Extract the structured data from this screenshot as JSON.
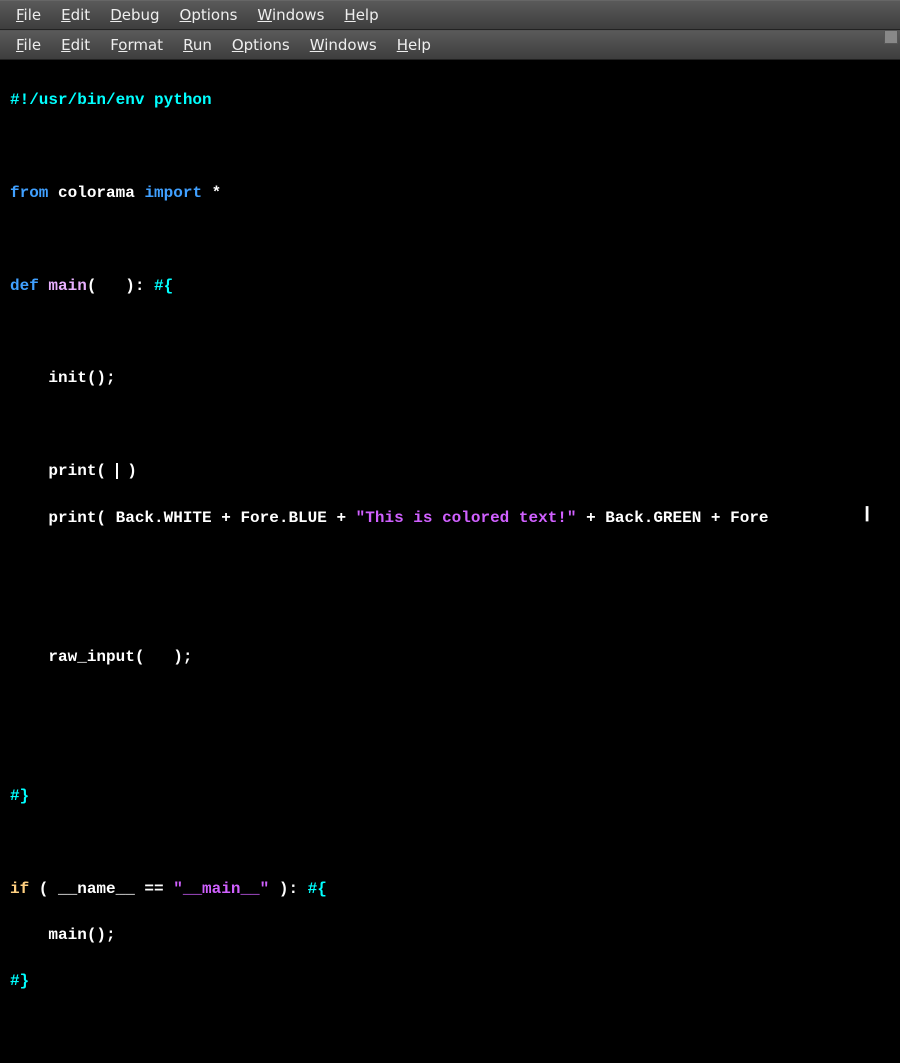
{
  "menubar1": {
    "file": "File",
    "edit": "Edit",
    "debug": "Debug",
    "options": "Options",
    "windows": "Windows",
    "help": "Help"
  },
  "menubar2": {
    "file": "File",
    "edit": "Edit",
    "format": "Format",
    "run": "Run",
    "options": "Options",
    "windows": "Windows",
    "help": "Help"
  },
  "code": {
    "l1": "#!/usr/bin/env python",
    "l3_from": "from",
    "l3_mod": "colorama",
    "l3_import": "import",
    "l3_star": "*",
    "l5_def": "def",
    "l5_main": "main",
    "l5_paren": "(   ):",
    "l5_brace": "#{",
    "l7_init": "init();",
    "l9_print": "print(",
    "l9_end": ")",
    "l10_print": "print(",
    "l10_a": " Back.WHITE + Fore.BLUE + ",
    "l10_str": "\"This is colored text!\"",
    "l10_b": " + Back.GREEN + Fore",
    "l13_raw": "raw_input(   );",
    "l16_close": "#}",
    "l18_if": "if",
    "l18_paren1": " ( ",
    "l18_name": "__name__",
    "l18_eq": " == ",
    "l18_str": "\"__main__\"",
    "l18_paren2": " ): ",
    "l18_brace": "#{",
    "l19_main": "main();",
    "l20_close": "#}"
  }
}
